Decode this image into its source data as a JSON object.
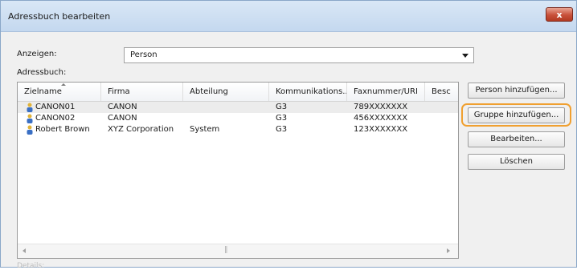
{
  "window": {
    "title": "Adressbuch bearbeiten",
    "close_label": "x"
  },
  "view": {
    "label": "Anzeigen:",
    "selected": "Person"
  },
  "addressbook_label": "Adressbuch:",
  "table": {
    "columns": [
      "Zielname",
      "Firma",
      "Abteilung",
      "Kommunikations...",
      "Faxnummer/URI",
      "Besc"
    ],
    "rows": [
      {
        "name": "CANON01",
        "company": "CANON",
        "department": "",
        "comm": "G3",
        "fax": "789XXXXXXX"
      },
      {
        "name": "CANON02",
        "company": "CANON",
        "department": "",
        "comm": "G3",
        "fax": "456XXXXXXX"
      },
      {
        "name": "Robert Brown",
        "company": "XYZ Corporation",
        "department": "System",
        "comm": "G3",
        "fax": "123XXXXXXX"
      }
    ]
  },
  "buttons": {
    "add_person": "Person hinzufügen...",
    "add_group": "Gruppe hinzufügen...",
    "edit": "Bearbeiten...",
    "delete": "Löschen"
  },
  "footer_label": "Details:",
  "colors": {
    "highlight": "#f0a030",
    "title_bar": "#c4d8ef",
    "close_button": "#c8503a"
  }
}
